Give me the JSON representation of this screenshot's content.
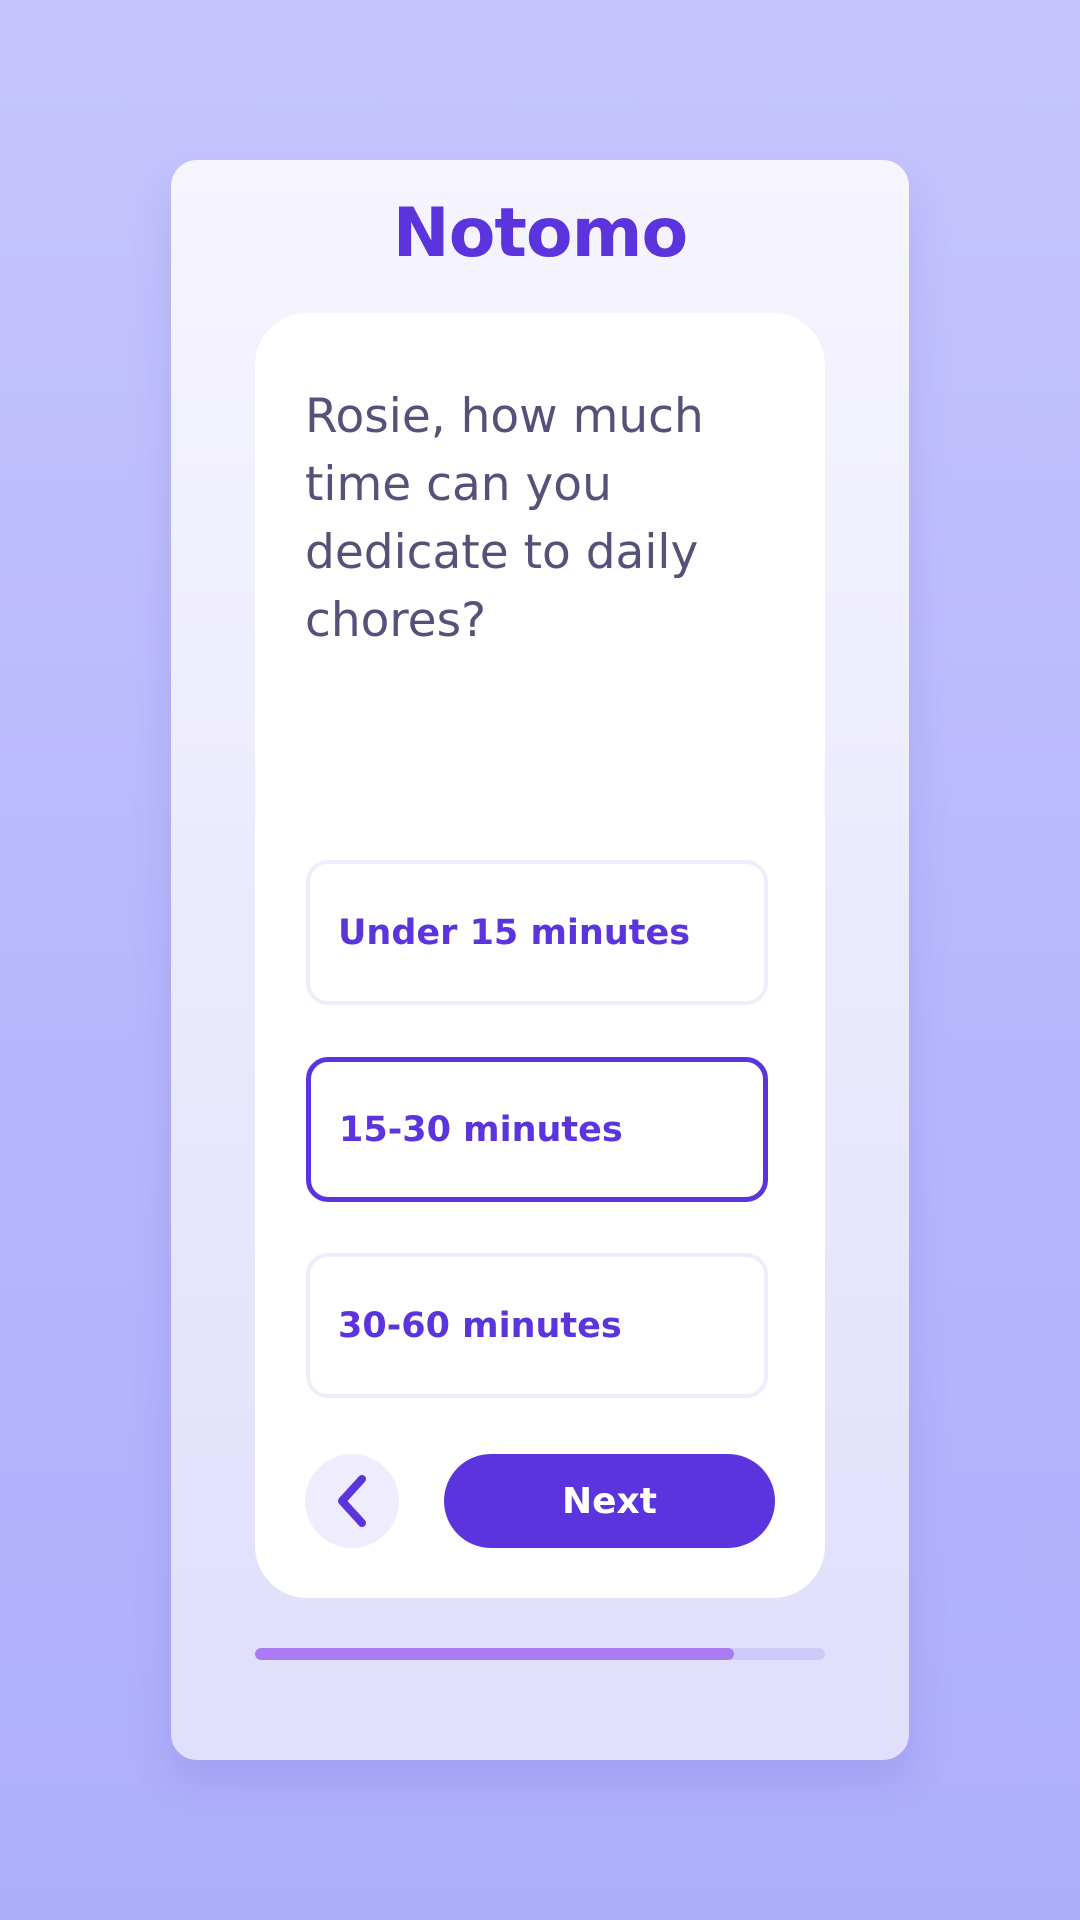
{
  "app": {
    "brand": "Notomo"
  },
  "question": {
    "text": "Rosie, how much time can you dedicate to daily chores?"
  },
  "options": [
    {
      "label": "Under 15 minutes",
      "selected": false
    },
    {
      "label": "15-30 minutes",
      "selected": true
    },
    {
      "label": "30-60 minutes",
      "selected": false
    }
  ],
  "navigation": {
    "back_icon": "chevron-left-icon",
    "next_label": "Next"
  },
  "progress": {
    "fraction": 0.84
  },
  "colors": {
    "accent": "#5b34de",
    "progress_fill": "#a97af2",
    "progress_track": "#cccbf7",
    "question_text": "#55527a"
  }
}
